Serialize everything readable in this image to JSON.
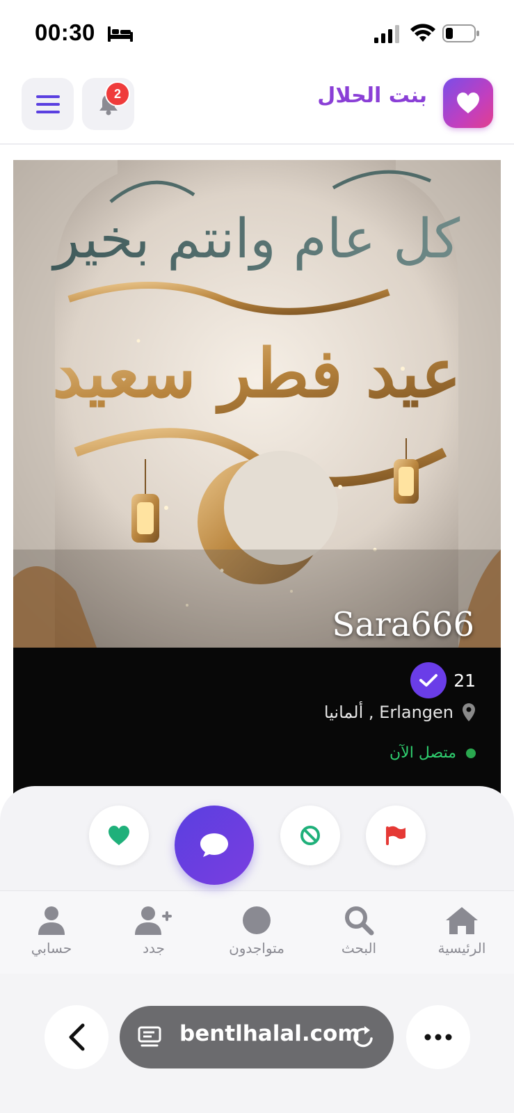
{
  "status_bar": {
    "time": "00:30",
    "icons": [
      "bed-icon",
      "cellular-signal-icon",
      "wifi-icon",
      "battery-icon"
    ]
  },
  "header": {
    "brand_name": "بنت الحلال",
    "notification_count": "2",
    "icons": [
      "heart-logo-icon",
      "bell-icon",
      "menu-icon"
    ],
    "accent_color": "#8a3fd6"
  },
  "profile": {
    "photo_text_line1": "كل عام وانتم بخير",
    "photo_text_line2": "عيد فطر سعيد",
    "name": "Sara666",
    "age": "21",
    "verified": true,
    "location": "ألمانيا , Erlangen",
    "online_status": "متصل الآن"
  },
  "actions": {
    "icons": [
      "heart-icon",
      "chat-icon",
      "block-icon",
      "flag-icon"
    ]
  },
  "bottom_nav": {
    "items": [
      {
        "label": "حسابي",
        "icon": "user-icon"
      },
      {
        "label": "جدد",
        "icon": "user-plus-icon"
      },
      {
        "label": "متواجدون",
        "icon": "circle-icon"
      },
      {
        "label": "البحث",
        "icon": "search-icon"
      },
      {
        "label": "الرئيسية",
        "icon": "home-icon"
      }
    ]
  },
  "browser": {
    "url": "bentlhalal.com",
    "icons": [
      "back-chevron-icon",
      "reader-icon",
      "reload-icon",
      "more-icon"
    ]
  },
  "colors": {
    "primary": "#6a3de8",
    "online": "#2fcf6f",
    "badge": "#ef3b3b",
    "like": "#1fb07a",
    "report": "#e53935"
  }
}
